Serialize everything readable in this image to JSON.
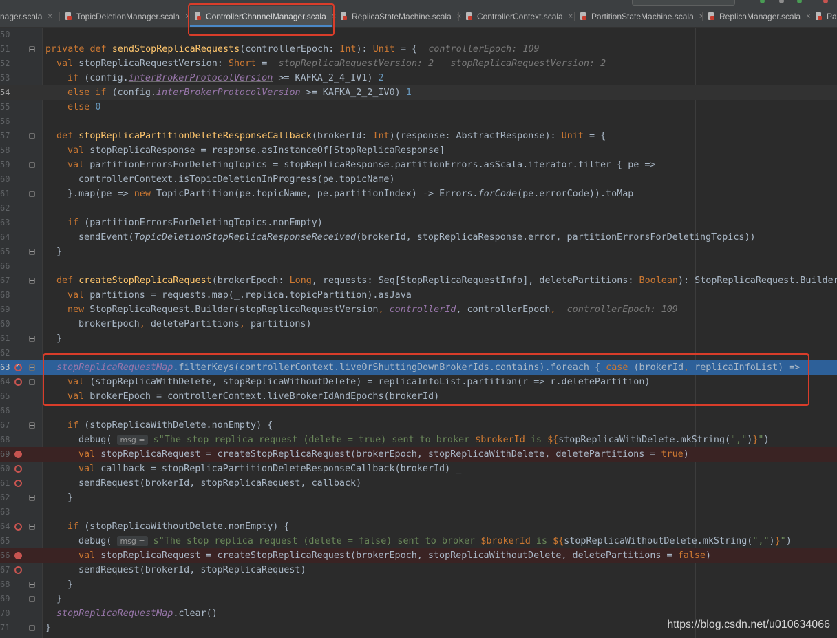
{
  "tabs": [
    {
      "label": "nager.scala"
    },
    {
      "label": "TopicDeletionManager.scala"
    },
    {
      "label": "ControllerChannelManager.scala"
    },
    {
      "label": "ReplicaStateMachine.scala"
    },
    {
      "label": "ControllerContext.scala"
    },
    {
      "label": "PartitionStateMachine.scala"
    },
    {
      "label": "ReplicaManager.scala"
    },
    {
      "label": "Par"
    }
  ],
  "close_glyph": "×",
  "colors": {
    "keyword": "#cc7832",
    "function": "#ffc66d",
    "number": "#6897bb",
    "string": "#6a8759",
    "field": "#9876aa",
    "exec_line": "#2d6099",
    "breakpoint": "#c75450",
    "annotation": "#d93d2a"
  },
  "gutter_numbers": [
    "50",
    "51",
    "52",
    "53",
    "54",
    "55",
    "56",
    "57",
    "58",
    "59",
    "60",
    "61",
    "62",
    "63",
    "64",
    "65",
    "66",
    "67",
    "68",
    "69",
    "60",
    "61",
    "62",
    "63",
    "64",
    "65",
    "66",
    "67",
    "68",
    "69",
    "60",
    "61",
    "62",
    "63",
    "64",
    "65",
    "66",
    "67",
    "68",
    "69",
    "70",
    "71"
  ],
  "code": {
    "l1": {
      "a": "private def ",
      "fn": "sendStopReplicaRequests",
      "b": "(controllerEpoch: ",
      "t": "Int",
      "c": "): ",
      "t2": "Unit",
      "d": " = {",
      "hint": "controllerEpoch: 109"
    },
    "l2": {
      "a": "val ",
      "b": "stopReplicaRequestVersion: ",
      "t": "Short",
      "c": " = ",
      "hint1": "stopReplicaRequestVersion: 2",
      "hint2": "stopReplicaRequestVersion: 2"
    },
    "l3": {
      "a": "if ",
      "b": "(config.",
      "f": "interBrokerProtocolVersion",
      "c": " >= KAFKA_2_4_IV1) ",
      "n": "2"
    },
    "l4": {
      "a": "else if ",
      "b": "(config.",
      "f": "interBrokerProtocolVersion",
      "c": " >= KAFKA_2_2_IV0) ",
      "n": "1"
    },
    "l5": {
      "a": "else ",
      "n": "0"
    },
    "l7": {
      "a": "def ",
      "fn": "stopReplicaPartitionDeleteResponseCallback",
      "b": "(brokerId: ",
      "t": "Int",
      "c": ")(response: AbstractResponse): ",
      "t2": "Unit",
      "d": " = {"
    },
    "l8": {
      "a": "val ",
      "b": "stopReplicaResponse = response.asInstanceOf[StopReplicaResponse]"
    },
    "l9": {
      "a": "val ",
      "b": "partitionErrorsForDeletingTopics = stopReplicaResponse.partitionErrors.asScala.iterator.filter { pe =>"
    },
    "l10": {
      "b": "controllerContext.isTopicDeletionInProgress(pe.topicName)"
    },
    "l11": {
      "a": "}.map(pe => ",
      "k": "new ",
      "b": "TopicPartition(pe.topicName, pe.partitionIndex) -> Errors.",
      "it": "forCode",
      "c": "(pe.errorCode)).toMap"
    },
    "l13": {
      "a": "if ",
      "b": "(partitionErrorsForDeletingTopics.nonEmpty)"
    },
    "l14": {
      "a": "sendEvent(",
      "it": "TopicDeletionStopReplicaResponseReceived",
      "b": "(brokerId, stopReplicaResponse.error, partitionErrorsForDeletingTopics))"
    },
    "l15": {
      "b": "}"
    },
    "l17": {
      "a": "def ",
      "fn": "createStopReplicaRequest",
      "b": "(brokerEpoch: ",
      "t": "Long",
      "c": ", requests: Seq[StopReplicaRequestInfo], deletePartitions: ",
      "t2": "Boolean",
      "d": "): StopReplicaRequest.Builder"
    },
    "l18": {
      "a": "val ",
      "b": "partitions = requests.map(_.replica.topicPartition).asJava"
    },
    "l19": {
      "a": "new ",
      "b": "StopReplicaRequest.Builder(stopReplicaRequestVersion",
      "k": ", ",
      "f": "controllerId",
      "c": ", controllerEpoch",
      "k2": ",",
      "hint": "controllerEpoch: 109"
    },
    "l20": {
      "b": "brokerEpoch",
      "k": ", ",
      "c": "deletePartitions",
      "k2": ", ",
      "d": "partitions)"
    },
    "l21": {
      "b": "}"
    },
    "l23": {
      "f": "stopReplicaRequestMap",
      "b": ".filterKeys(controllerContext.liveOrShuttingDownBrokerIds.contains).foreach { ",
      "k": "case ",
      "c": "(brokerId",
      "k2": ", ",
      "d": "replicaInfoList) =>"
    },
    "l24": {
      "a": "val ",
      "b": "(stopReplicaWithDelete, stopReplicaWithoutDelete) = replicaInfoList.partition(r => r.deletePartition)"
    },
    "l25": {
      "a": "val ",
      "b": "brokerEpoch = controllerContext.liveBrokerIdAndEpochs(brokerId)"
    },
    "l27": {
      "a": "if ",
      "b": "(stopReplicaWithDelete.nonEmpty) {"
    },
    "l28": {
      "a": "debug(",
      "tag": "msg =",
      "s": "s\"The stop replica request (delete = true) sent to broker ",
      "v": "$brokerId",
      "s2": " is ",
      "v2": "${",
      "b": "stopReplicaWithDelete.mkString(",
      "s3": "\",\"",
      "c": ")",
      "v3": "}",
      "s4": "\"",
      "d": ")"
    },
    "l29": {
      "a": "val ",
      "b": "stopReplicaRequest = createStopReplicaRequest(brokerEpoch, stopReplicaWithDelete, deletePartitions = ",
      "k": "true",
      "c": ")"
    },
    "l30": {
      "a": "val ",
      "b": "callback = stopReplicaPartitionDeleteResponseCallback(brokerId) _"
    },
    "l31": {
      "b": "sendRequest(brokerId, stopReplicaRequest, callback)"
    },
    "l32": {
      "b": "}"
    },
    "l34": {
      "a": "if ",
      "b": "(stopReplicaWithoutDelete.nonEmpty) {"
    },
    "l35": {
      "a": "debug(",
      "tag": "msg =",
      "s": "s\"The stop replica request (delete = false) sent to broker ",
      "v": "$brokerId",
      "s2": " is ",
      "v2": "${",
      "b": "stopReplicaWithoutDelete.mkString(",
      "s3": "\",\"",
      "c": ")",
      "v3": "}",
      "s4": "\"",
      "d": ")"
    },
    "l36": {
      "a": "val ",
      "b": "stopReplicaRequest = createStopReplicaRequest(brokerEpoch, stopReplicaWithoutDelete, deletePartitions = ",
      "k": "false",
      "c": ")"
    },
    "l37": {
      "b": "sendRequest(brokerId, stopReplicaRequest)"
    },
    "l38": {
      "b": "}"
    },
    "l39": {
      "b": "}"
    },
    "l40": {
      "f": "stopReplicaRequestMap",
      "b": ".clear()"
    },
    "l41": {
      "b": "}"
    }
  },
  "watermark": "https://blog.csdn.net/u010634066"
}
